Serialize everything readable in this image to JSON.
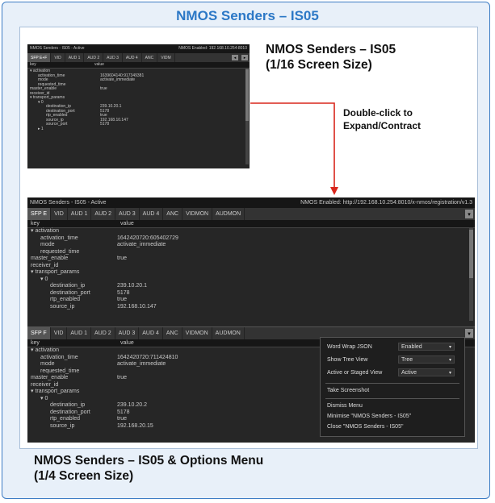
{
  "title": "NMOS Senders – IS05",
  "captions": {
    "small_l1": "NMOS Senders – IS05",
    "small_l2": "(1/16 Screen Size)",
    "dbl_l1": "Double-click to",
    "dbl_l2": "Expand/Contract",
    "bottom_l1": "NMOS Senders – IS05 & Options Menu",
    "bottom_l2": "(1/4 Screen Size)"
  },
  "small": {
    "title": "NMOS Senders - IS05 - Active",
    "status": "NMOS Enabled: 192.168.10.254:8010",
    "tabs": [
      "SFP E+F",
      "VID",
      "AUD 1",
      "AUD 2",
      "AUD 3",
      "AUD 4",
      "ANC",
      "VIDM"
    ],
    "col_key": "key",
    "col_value": "value",
    "rows": [
      {
        "k": "▾ activation",
        "v": ""
      },
      {
        "k": "activation_time",
        "v": "1639604140:917349381"
      },
      {
        "k": "mode",
        "v": "activate_immediate"
      },
      {
        "k": "requested_time",
        "v": ""
      },
      {
        "k": "master_enable",
        "v": "true"
      },
      {
        "k": "receiver_id",
        "v": ""
      },
      {
        "k": "▾ transport_params",
        "v": ""
      },
      {
        "k": "▾ 0",
        "v": ""
      },
      {
        "k": "destination_ip",
        "v": "239.10.20.1"
      },
      {
        "k": "destination_port",
        "v": "5178"
      },
      {
        "k": "rtp_enabled",
        "v": "true"
      },
      {
        "k": "source_ip",
        "v": "192.168.10.147"
      },
      {
        "k": "source_port",
        "v": "5178"
      },
      {
        "k": "▸ 1",
        "v": ""
      }
    ]
  },
  "big": {
    "title": "NMOS Senders - IS05 - Active",
    "status": "NMOS Enabled: http://192.168.10.254:8010/x-nmos/registration/v1.3",
    "panel1": {
      "tabs": [
        "SFP E",
        "VID",
        "AUD 1",
        "AUD 2",
        "AUD 3",
        "AUD 4",
        "ANC",
        "VIDMON",
        "AUDMON"
      ],
      "col_key": "key",
      "col_value": "value",
      "rows": [
        {
          "k": "▾ activation",
          "v": ""
        },
        {
          "k": "activation_time",
          "v": "1642420720:605402729"
        },
        {
          "k": "mode",
          "v": "activate_immediate"
        },
        {
          "k": "requested_time",
          "v": ""
        },
        {
          "k": "master_enable",
          "v": "true"
        },
        {
          "k": "receiver_id",
          "v": ""
        },
        {
          "k": "▾ transport_params",
          "v": ""
        },
        {
          "k": "▾ 0",
          "v": ""
        },
        {
          "k": "destination_ip",
          "v": "239.10.20.1"
        },
        {
          "k": "destination_port",
          "v": "5178"
        },
        {
          "k": "rtp_enabled",
          "v": "true"
        },
        {
          "k": "source_ip",
          "v": "192.168.10.147"
        }
      ]
    },
    "panel2": {
      "tabs": [
        "SFP F",
        "VID",
        "AUD 1",
        "AUD 2",
        "AUD 3",
        "AUD 4",
        "ANC",
        "VIDMON",
        "AUDMON"
      ],
      "col_key": "key",
      "col_value": "value",
      "rows": [
        {
          "k": "▾ activation",
          "v": ""
        },
        {
          "k": "activation_time",
          "v": "1642420720:711424810"
        },
        {
          "k": "mode",
          "v": "activate_immediate"
        },
        {
          "k": "requested_time",
          "v": ""
        },
        {
          "k": "master_enable",
          "v": "true"
        },
        {
          "k": "receiver_id",
          "v": ""
        },
        {
          "k": "▾ transport_params",
          "v": ""
        },
        {
          "k": "▾ 0",
          "v": ""
        },
        {
          "k": "destination_ip",
          "v": "239.10.20.2"
        },
        {
          "k": "destination_port",
          "v": "5178"
        },
        {
          "k": "rtp_enabled",
          "v": "true"
        },
        {
          "k": "source_ip",
          "v": "192.168.20.15"
        }
      ]
    }
  },
  "menu": {
    "word_wrap_label": "Word Wrap JSON",
    "word_wrap_value": "Enabled",
    "tree_view_label": "Show Tree View",
    "tree_view_value": "Tree",
    "active_label": "Active or Staged View",
    "active_value": "Active",
    "screenshot": "Take Screenshot",
    "dismiss": "Dismiss Menu",
    "minimise": "Minimise \"NMOS Senders - IS05\"",
    "close": "Close \"NMOS Senders - IS05\""
  },
  "colors": {
    "accent": "#2c78c6",
    "arrow": "#d9261c",
    "window_bg": "#262626"
  }
}
